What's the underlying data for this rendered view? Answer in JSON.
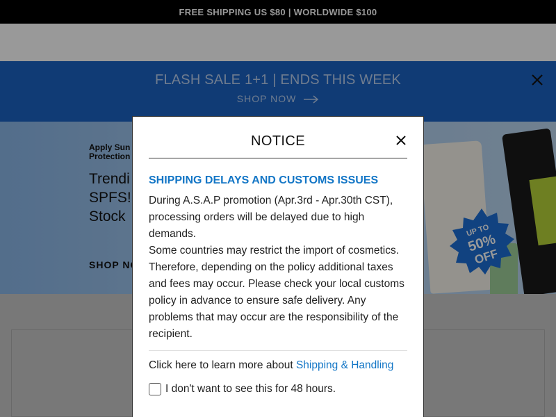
{
  "topbar": {
    "text": "FREE SHIPPING US $80 | WORLDWIDE $100"
  },
  "flash_banner": {
    "title": "FLASH SALE 1+1 | ENDS THIS WEEK",
    "cta": "SHOP NOW",
    "close_icon": "close-icon"
  },
  "hero": {
    "eyebrow": "Apply Sun\nProtection",
    "title": "Trendi\nSPFS!\nStock",
    "cta": "SHOP NO",
    "badge_line1": "UP TO",
    "badge_line2": "50%",
    "badge_line3": "OFF"
  },
  "modal": {
    "title": "NOTICE",
    "close_icon": "close-icon",
    "heading": "SHIPPING DELAYS AND CUSTOMS ISSUES",
    "body_p1": "During A.S.A.P promotion (Apr.3rd - Apr.30th CST), processing orders will be delayed due to high demands.",
    "body_p2": "Some countries may restrict the import of cosmetics. Therefore, depending on the policy additional taxes and fees may occur. Please check your local customs policy in advance to ensure safe delivery. Any problems that may occur are the responsibility of the recipient.",
    "learn_more_prefix": "Click here to learn more about ",
    "learn_more_link": "Shipping & Handling",
    "dont_show_label": "I don't want to see this for 48 hours.",
    "dont_show_checked": false
  },
  "colors": {
    "flash_bg": "#1c63c4",
    "link": "#1376c6",
    "badge": "#1d6fd6"
  }
}
